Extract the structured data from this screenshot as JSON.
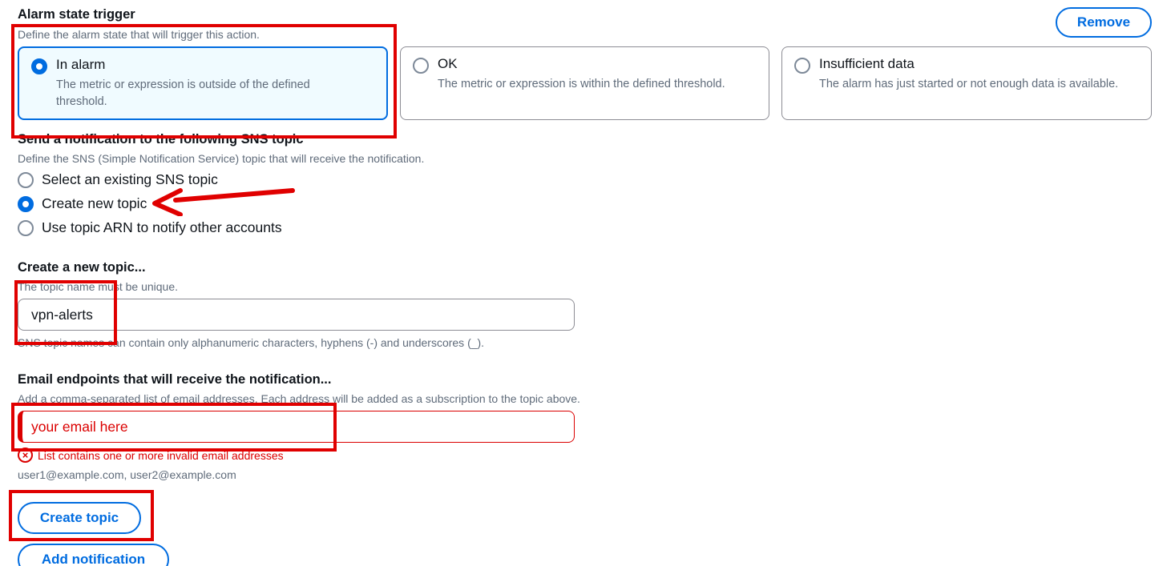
{
  "alarm_state": {
    "title": "Alarm state trigger",
    "description": "Define the alarm state that will trigger this action.",
    "remove_label": "Remove",
    "options": [
      {
        "label": "In alarm",
        "description": "The metric or expression is outside of the defined threshold.",
        "selected": true
      },
      {
        "label": "OK",
        "description": "The metric or expression is within the defined threshold.",
        "selected": false
      },
      {
        "label": "Insufficient data",
        "description": "The alarm has just started or not enough data is available.",
        "selected": false
      }
    ]
  },
  "sns": {
    "title": "Send a notification to the following SNS topic",
    "description": "Define the SNS (Simple Notification Service) topic that will receive the notification.",
    "options": [
      {
        "label": "Select an existing SNS topic",
        "selected": false
      },
      {
        "label": "Create new topic",
        "selected": true
      },
      {
        "label": "Use topic ARN to notify other accounts",
        "selected": false
      }
    ]
  },
  "new_topic": {
    "title": "Create a new topic...",
    "description": "The topic name must be unique.",
    "value": "vpn-alerts",
    "constraint": "SNS topic names can contain only alphanumeric characters, hyphens (-) and underscores (_)."
  },
  "email": {
    "title": "Email endpoints that will receive the notification...",
    "description": "Add a comma-separated list of email addresses. Each address will be added as a subscription to the topic above.",
    "value": "your email here",
    "error": "List contains one or more invalid email addresses",
    "hint": "user1@example.com, user2@example.com"
  },
  "actions": {
    "create_topic": "Create topic",
    "add_notification": "Add notification"
  },
  "colors": {
    "accent": "#006ce0",
    "error": "#db0000",
    "annotation": "#e00000"
  }
}
